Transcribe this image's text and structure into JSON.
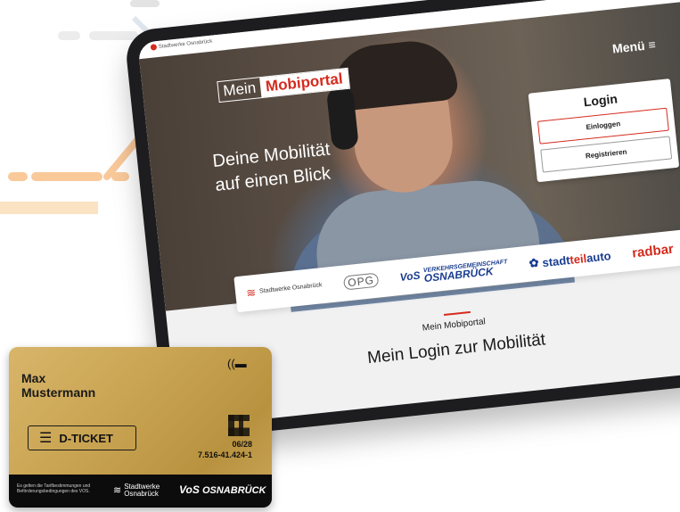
{
  "topbar": {
    "logo": "Stadtwerke Osnabrück"
  },
  "header": {
    "brand_part1": "Mein",
    "brand_part2": "Mobiportal",
    "menu_label": "Menü",
    "menu_icon": "≡"
  },
  "hero": {
    "headline_line1": "Deine Mobilität",
    "headline_line2": "auf einen Blick"
  },
  "login": {
    "title": "Login",
    "login_button": "Einloggen",
    "register_button": "Registrieren"
  },
  "partners": {
    "stadtwerke": "Stadtwerke Osnabrück",
    "opg": "OPG",
    "vos_small": "VERKEHRSGEMEINSCHAFT",
    "vos": "OSNABRÜCK",
    "stadtteilauto_prefix": "stadt",
    "stadtteilauto_accent": "teil",
    "stadtteilauto_suffix": "auto",
    "radbar": "radbar"
  },
  "section": {
    "label": "Mein Mobiportal",
    "title": "Mein Login zur Mobilität"
  },
  "card": {
    "first_name": "Max",
    "last_name": "Mustermann",
    "ticket": "D-TICKET",
    "expiry": "06/28",
    "number": "7.516-41.424-1",
    "terms": "Es gelten die Tarifbestimmungen und Beförderungsbedingungen des VOS.",
    "stadtwerke": "Stadtwerke Osnabrück",
    "vos": "OSNABRÜCK"
  },
  "colors": {
    "accent": "#d52b1e",
    "card_gold": "#c9a452",
    "navy": "#1a3d8f"
  }
}
